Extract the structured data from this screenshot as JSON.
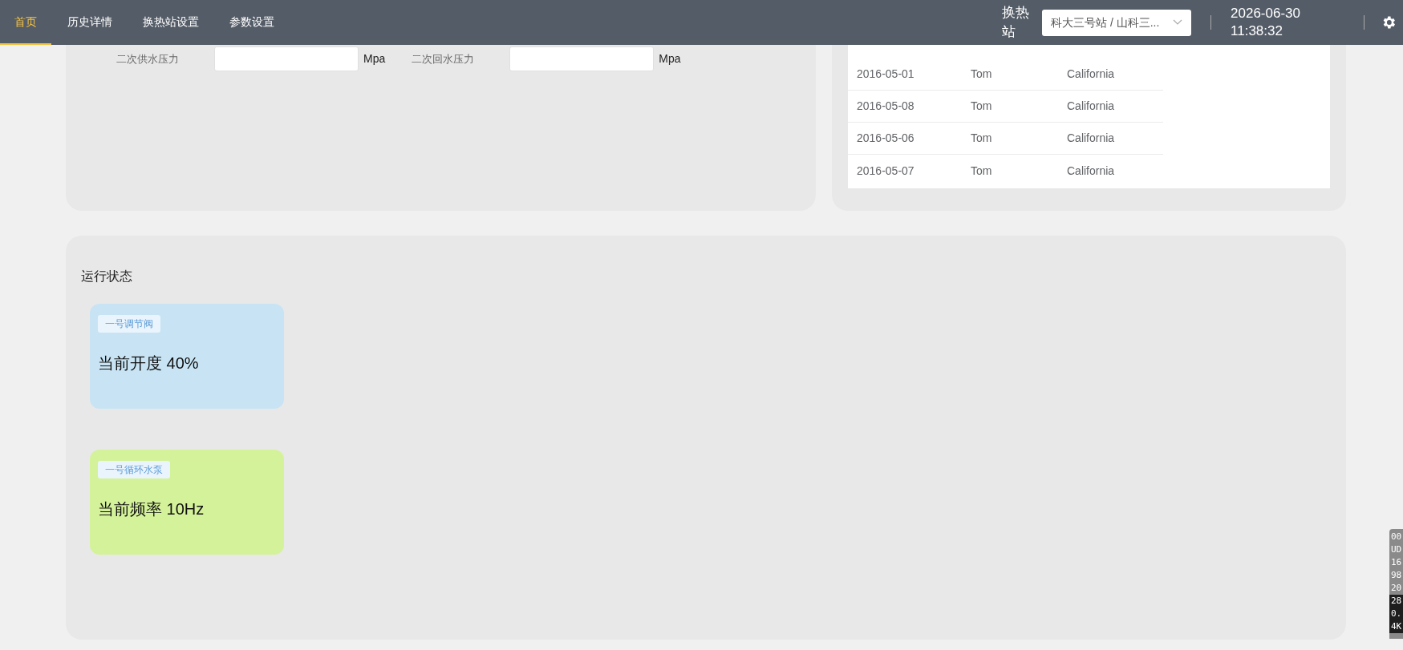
{
  "nav": {
    "tabs": [
      {
        "label": "首页",
        "selected": true
      },
      {
        "label": "历史详情",
        "selected": false
      },
      {
        "label": "换热站设置",
        "selected": false
      },
      {
        "label": "参数设置",
        "selected": false
      }
    ],
    "station_label": "换热站",
    "station_select": "科大三号站 / 山科三...",
    "date": "2026-06-30",
    "time": "11:38:32"
  },
  "pressure_form": {
    "fields": [
      {
        "label": "二次供水压力",
        "unit": "Mpa"
      },
      {
        "label": "二次回水压力",
        "unit": "Mpa"
      }
    ]
  },
  "table": {
    "rows": [
      [
        "2016-05-01",
        "Tom",
        "California"
      ],
      [
        "2016-05-08",
        "Tom",
        "California"
      ],
      [
        "2016-05-06",
        "Tom",
        "California"
      ],
      [
        "2016-05-07",
        "Tom",
        "California"
      ]
    ]
  },
  "status": {
    "title": "运行状态",
    "cards": [
      {
        "tag": "一号调节阀",
        "value": "当前开度 40%",
        "color": "#c8e4f4"
      },
      {
        "tag": "一号循环水泵",
        "value": "当前频率 10Hz",
        "color": "#d4f29a"
      }
    ]
  },
  "overlay_panel": {
    "lines": [
      {
        "text": "00",
        "dark": false
      },
      {
        "text": "UD",
        "dark": false
      },
      {
        "text": "16",
        "dark": false
      },
      {
        "text": "98",
        "dark": false
      },
      {
        "text": "20",
        "dark": false
      },
      {
        "text": "28",
        "dark": true
      },
      {
        "text": "0.",
        "dark": true
      },
      {
        "text": "4K",
        "dark": true
      }
    ]
  }
}
